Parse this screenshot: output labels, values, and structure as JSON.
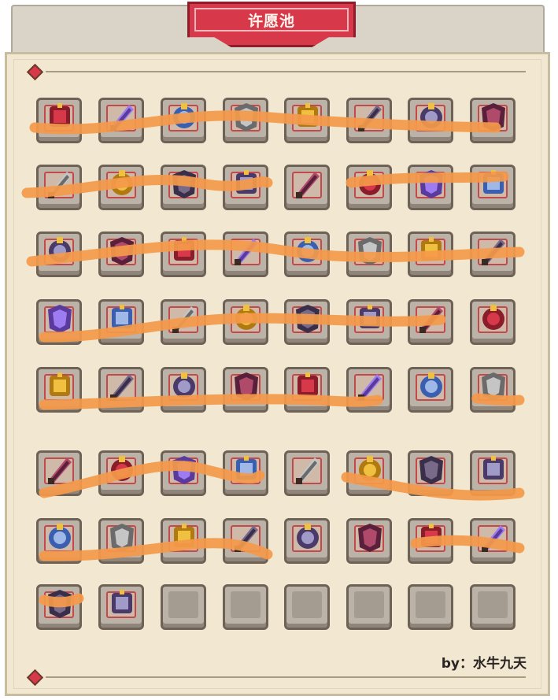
{
  "title": "许愿池",
  "credit": "by：水牛九天",
  "colors": {
    "banner": "#d8394a",
    "panel": "#f2e8d2",
    "slot": "#bcb3a8",
    "scribble": "#f59a4a"
  },
  "grid": {
    "rows": [
      [
        "blade-icon",
        "purple-sword-icon",
        "rune-orb-icon",
        "battle-axe-icon",
        "golden-crossbow-icon",
        "dark-cannon-icon",
        "shadow-crossbow-icon",
        "demon-helmet-icon"
      ],
      [
        "horned-helmet-icon",
        "silver-gun-icon",
        "backpack-icon",
        "bronze-chest-icon",
        "wooden-armor-icon",
        "golden-gauntlet-icon",
        "red-scythe-icon",
        "golden-ring-icon"
      ],
      [
        "fire-gauntlet-icon",
        "crab-armor-icon",
        "spear-icon",
        "assault-rifle-icon",
        "blue-slime-icon",
        "demon-armor-icon",
        "green-gem-amulet-icon",
        "gold-claw-icon"
      ],
      [
        "gold-bracelet-icon",
        "bronze-box-icon",
        "blue-tome-icon",
        "golden-boots-icon",
        "amber-shard-icon",
        "red-dagger-icon",
        "golden-staff-icon",
        "teal-bow-icon"
      ],
      [
        "stone-gauntlet-icon",
        "ice-axe-icon",
        "dark-rifle-icon",
        "golden-trident-icon",
        "silver-crossbow-icon",
        "crimson-spear-icon",
        "fist-sigil-icon",
        "fire-boomerang-icon"
      ],
      [
        "flame-staff-icon",
        "violet-crystals-icon",
        "crimson-belt-icon",
        "pink-frame-icon",
        "lava-cloak-icon",
        "golden-chest-armor-icon",
        "red-robe-icon",
        "red-lightsaber-icon"
      ],
      [
        "ice-blade-icon",
        "rubber-chicken-icon",
        "swordfish-icon",
        "water-gun-icon",
        "diving-mask-icon",
        "red-shield-icon",
        "silver-scythe-icon",
        "treasure-chest-icon"
      ],
      [
        "blue-cape-icon",
        "wolf-helmet-icon",
        "empty-slot",
        "empty-slot",
        "empty-slot",
        "empty-slot",
        "empty-slot",
        "empty-slot"
      ]
    ]
  }
}
